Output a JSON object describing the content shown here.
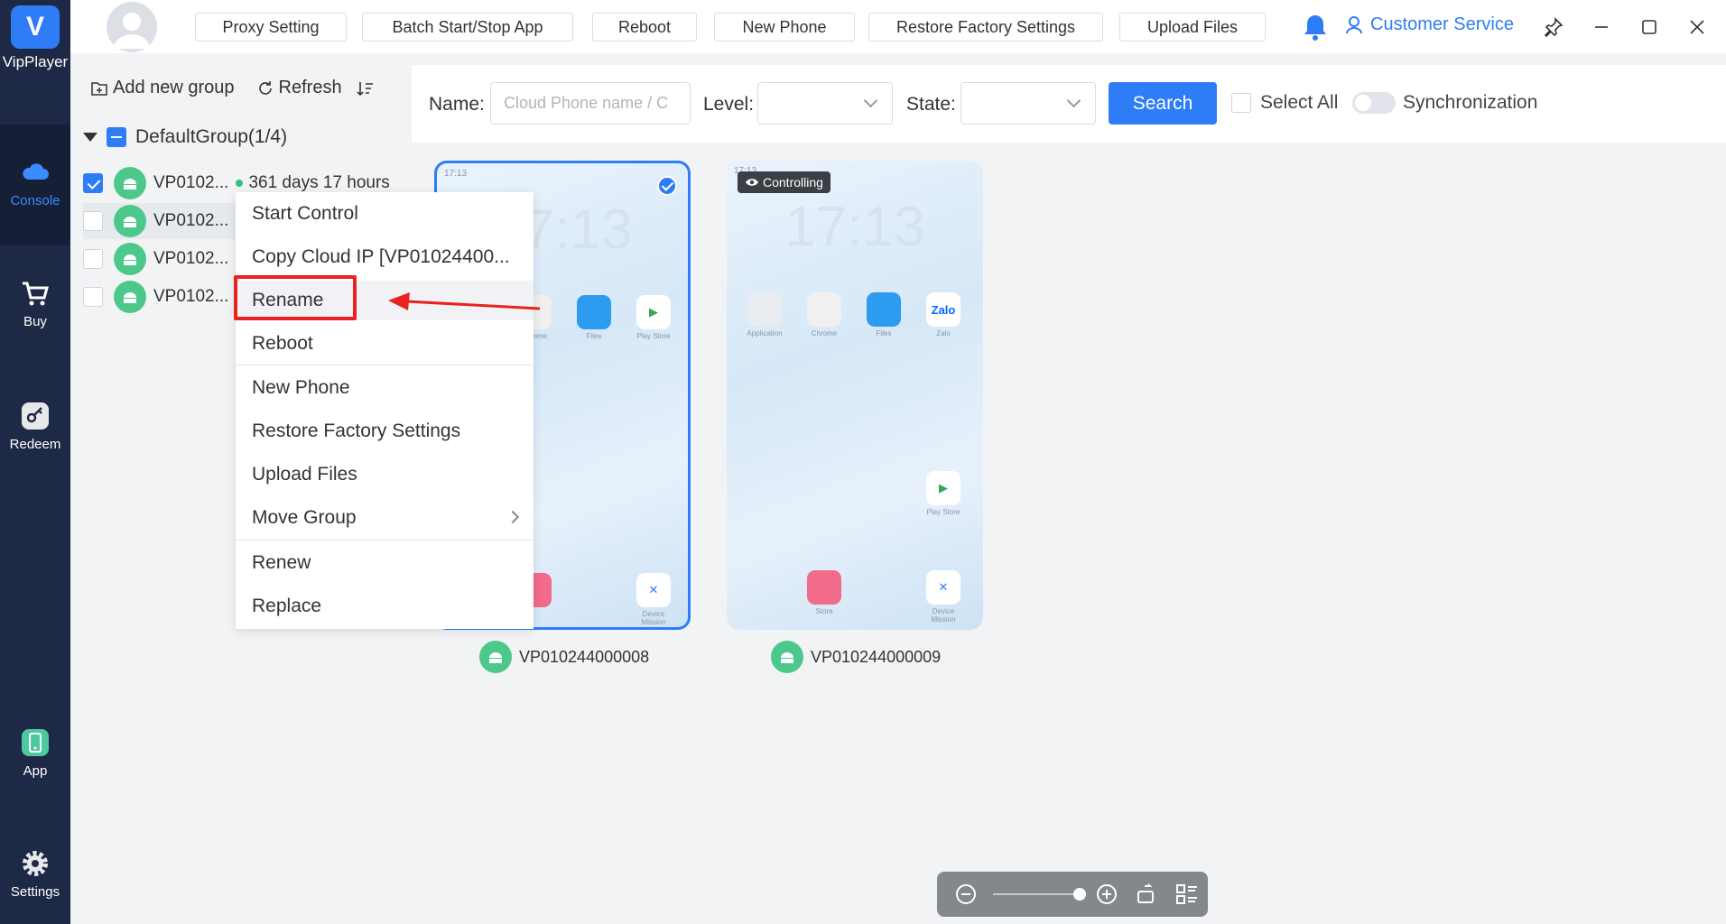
{
  "app": {
    "name": "VipPlayer"
  },
  "leftnav": [
    {
      "label": "Console",
      "active": true
    },
    {
      "label": "Buy"
    },
    {
      "label": "Redeem"
    },
    {
      "label": "App"
    },
    {
      "label": "Settings"
    }
  ],
  "toolbar": {
    "proxy": "Proxy Setting",
    "batch": "Batch Start/Stop App",
    "reboot": "Reboot",
    "new_phone": "New Phone",
    "restore": "Restore Factory Settings",
    "upload": "Upload Files",
    "customer_service": "Customer Service"
  },
  "sidebar": {
    "add_group": "Add new group",
    "refresh": "Refresh",
    "group_name": "DefaultGroup(1/4)",
    "devices": [
      {
        "name": "VP0102...",
        "status": "361 days 17 hours",
        "checked": true
      },
      {
        "name": "VP0102...",
        "status": "",
        "checked": false
      },
      {
        "name": "VP0102...",
        "status": "",
        "checked": false
      },
      {
        "name": "VP0102...",
        "status": "",
        "checked": false
      }
    ]
  },
  "filters": {
    "name_label": "Name:",
    "name_placeholder": "Cloud Phone name / C",
    "level_label": "Level:",
    "state_label": "State:",
    "search": "Search",
    "select_all": "Select All",
    "sync": "Synchronization"
  },
  "phones": [
    {
      "id": "VP010244000008",
      "time": "17:13",
      "clock": "17:13",
      "selected": true
    },
    {
      "id": "VP010244000009",
      "time": "17:13",
      "clock": "17:13",
      "badge": "Controlling"
    }
  ],
  "phone_apps": {
    "application": "Application",
    "chrome": "Chrome",
    "files": "Files",
    "play": "Play Store",
    "zalo_icon": "Zalo",
    "zalo": "Zalo",
    "store": "Store",
    "device_mission": "Device Mission"
  },
  "context_menu": {
    "items": [
      "Start Control",
      "Copy Cloud IP [VP01024400...",
      "Rename",
      "Reboot",
      "New Phone",
      "Restore Factory Settings",
      "Upload Files",
      "Move Group",
      "Renew",
      "Replace"
    ],
    "highlighted": "Rename"
  },
  "zoom": {
    "level": 1.0
  },
  "colors": {
    "accent": "#2f7df6",
    "nav_bg": "#1e2a45",
    "highlight_red": "#e8221f"
  }
}
